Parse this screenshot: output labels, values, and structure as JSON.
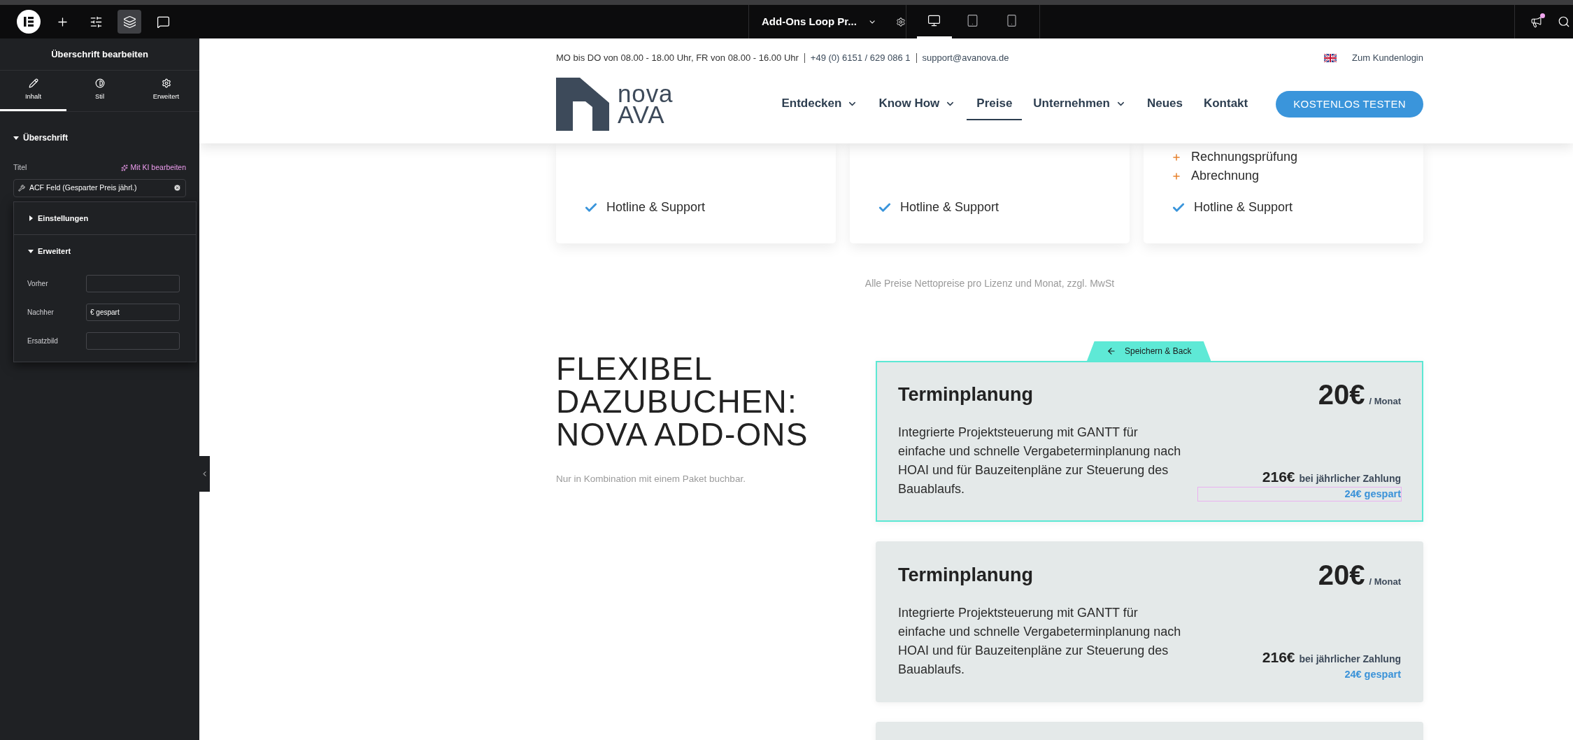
{
  "editor_toolbar": {
    "tools": [
      {
        "kind": "add",
        "selected": false
      },
      {
        "kind": "settings",
        "selected": false
      },
      {
        "kind": "layers",
        "selected": true
      },
      {
        "kind": "comments",
        "selected": false
      }
    ],
    "document_title": "Add-Ons Loop Pr...",
    "devices": [
      {
        "kind": "desktop",
        "selected": true
      },
      {
        "kind": "tablet",
        "selected": false
      },
      {
        "kind": "mobile",
        "selected": false
      }
    ],
    "has_notification": true
  },
  "panel": {
    "title": "Überschrift bearbeiten",
    "tabs": [
      {
        "kind": "content",
        "label": "Inhalt",
        "selected": true
      },
      {
        "kind": "style",
        "label": "Stil",
        "selected": false
      },
      {
        "kind": "advanced",
        "label": "Erweitert",
        "selected": false
      }
    ],
    "section": {
      "title": "Überschrift",
      "expanded": true
    },
    "field_label": "Titel",
    "ai_link": "Mit KI bearbeiten",
    "dynamic_value": "ACF Feld (Gesparter Preis jährl.)",
    "popover": {
      "groups": [
        {
          "title": "Einstellungen",
          "expanded": false
        },
        {
          "title": "Erweitert",
          "expanded": true,
          "fields": [
            {
              "label": "Vorher"
            },
            {
              "label": "Nachher",
              "value": "€ gespart"
            },
            {
              "label": "Ersatzbild"
            }
          ]
        }
      ]
    }
  },
  "site": {
    "topbar": {
      "hours": "MO bis DO von 08.00 - 18.00 Uhr, FR von 08.00 - 16.00 Uhr",
      "phone": "+49 (0) 6151 / 629 086 1",
      "email": "support@avanova.de",
      "login": "Zum Kundenlogin"
    },
    "logo": {
      "line1": "nova",
      "line2": "AVA"
    },
    "nav": [
      {
        "label": "Entdecken",
        "dropdown": true,
        "selected": false
      },
      {
        "label": "Know How",
        "dropdown": true,
        "selected": false
      },
      {
        "label": "Preise",
        "dropdown": false,
        "selected": true
      },
      {
        "label": "Unternehmen",
        "dropdown": true,
        "selected": false
      },
      {
        "label": "Neues",
        "dropdown": false,
        "selected": false
      },
      {
        "label": "Kontakt",
        "dropdown": false,
        "selected": false
      }
    ],
    "cta": "KOSTENLOS TESTEN",
    "plan_cards": [
      {
        "feature": "Hotline & Support"
      },
      {
        "feature": "Hotline & Support"
      },
      {
        "extras": [
          "Rechnungsprüfung",
          "Abrechnung"
        ],
        "feature": "Hotline & Support"
      }
    ],
    "price_note": "Alle Preise Nettopreise pro Lizenz und Monat, zzgl. MwSt",
    "addons": {
      "heading": [
        "FLEXIBEL",
        "DAZUBUCHEN:",
        "NOVA ADD-ONS"
      ],
      "subtitle": "Nur in Kombination mit einem Paket buchbar.",
      "save_back": "Speichern & Back",
      "cards": [
        {
          "title": "Terminplanung",
          "description": "Integrierte Projektsteuerung mit GANTT für einfache und schnelle Vergabeterminplanung nach HOAI und für Bauzeitenpläne zur Steuerung des Bauablaufs.",
          "price": "20€",
          "per": "/ Monat",
          "yearly_price": "216€",
          "yearly_label": "bei jährlicher Zahlung",
          "saving": "24€ gespart",
          "selected": true
        },
        {
          "title": "Terminplanung",
          "description": "Integrierte Projektsteuerung mit GANTT für einfache und schnelle Vergabeterminplanung nach HOAI und für Bauzeitenpläne zur Steuerung des Bauablaufs.",
          "price": "20€",
          "per": "/ Monat",
          "yearly_price": "216€",
          "yearly_label": "bei jährlicher Zahlung",
          "saving": "24€ gespart",
          "selected": false
        },
        {
          "selected": false
        }
      ]
    }
  }
}
